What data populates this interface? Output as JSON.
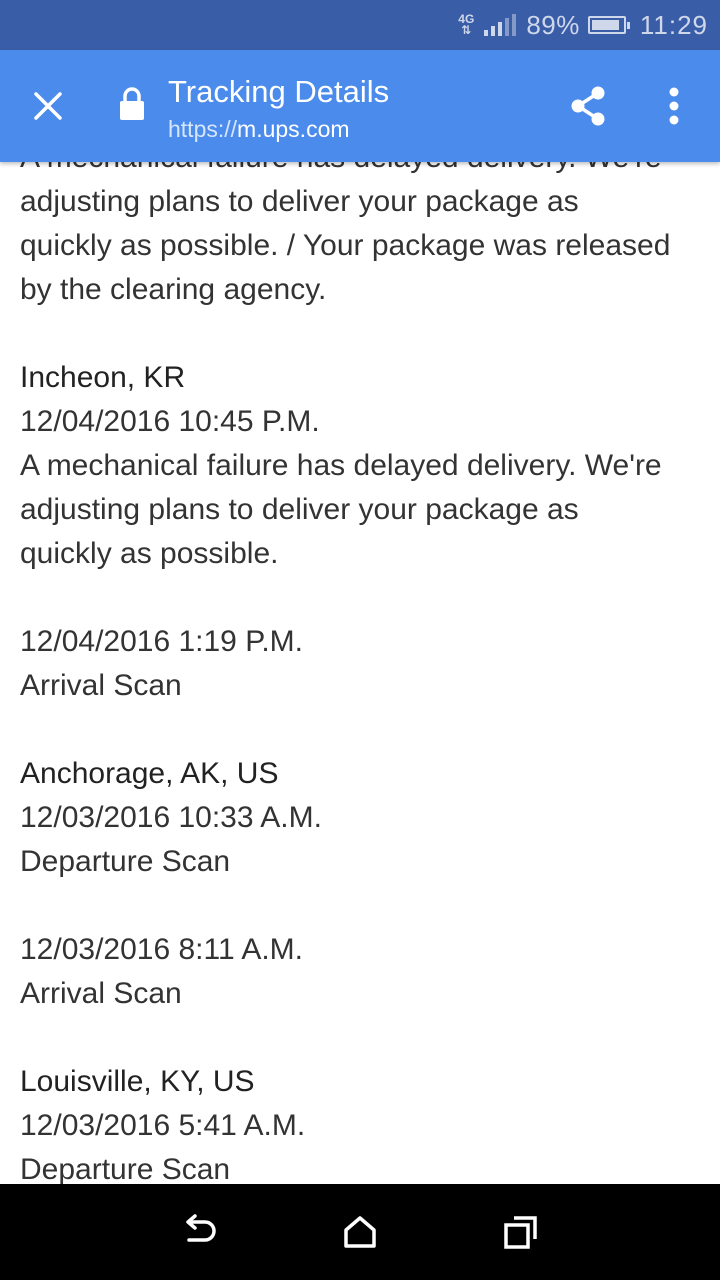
{
  "status_bar": {
    "network": "4G",
    "battery_percent": "89%",
    "battery_level": 0.89,
    "time": "11:29"
  },
  "app_bar": {
    "title": "Tracking Details",
    "url_scheme": "https://",
    "url_host": "m.ups.com",
    "icons": [
      "close-icon",
      "lock-icon",
      "share-icon",
      "more-vert-icon"
    ],
    "color": "#4a8bec"
  },
  "tracking": {
    "partial_top_line": "A mechanical failure has delayed delivery. We're",
    "partial_lines": [
      "adjusting plans to deliver your package as",
      "quickly as possible. / Your package was released",
      "by the clearing agency."
    ],
    "events": [
      {
        "location": "Incheon, KR",
        "datetime": "12/04/2016 10:45 P.M.",
        "description_lines": [
          "A mechanical failure has delayed delivery. We're",
          "adjusting plans to deliver your package as",
          "quickly as possible."
        ]
      },
      {
        "location": "",
        "datetime": "12/04/2016 1:19 P.M.",
        "description_lines": [
          "Arrival Scan"
        ]
      },
      {
        "location": "Anchorage, AK, US",
        "datetime": "12/03/2016 10:33 A.M.",
        "description_lines": [
          "Departure Scan"
        ]
      },
      {
        "location": "",
        "datetime": "12/03/2016 8:11 A.M.",
        "description_lines": [
          "Arrival Scan"
        ]
      },
      {
        "location": "Louisville, KY, US",
        "datetime": "12/03/2016 5:41 A.M.",
        "description_lines": [
          "Departure Scan"
        ]
      }
    ]
  },
  "nav_bar": {
    "icons": [
      "back-icon",
      "home-icon",
      "recents-icon"
    ]
  }
}
